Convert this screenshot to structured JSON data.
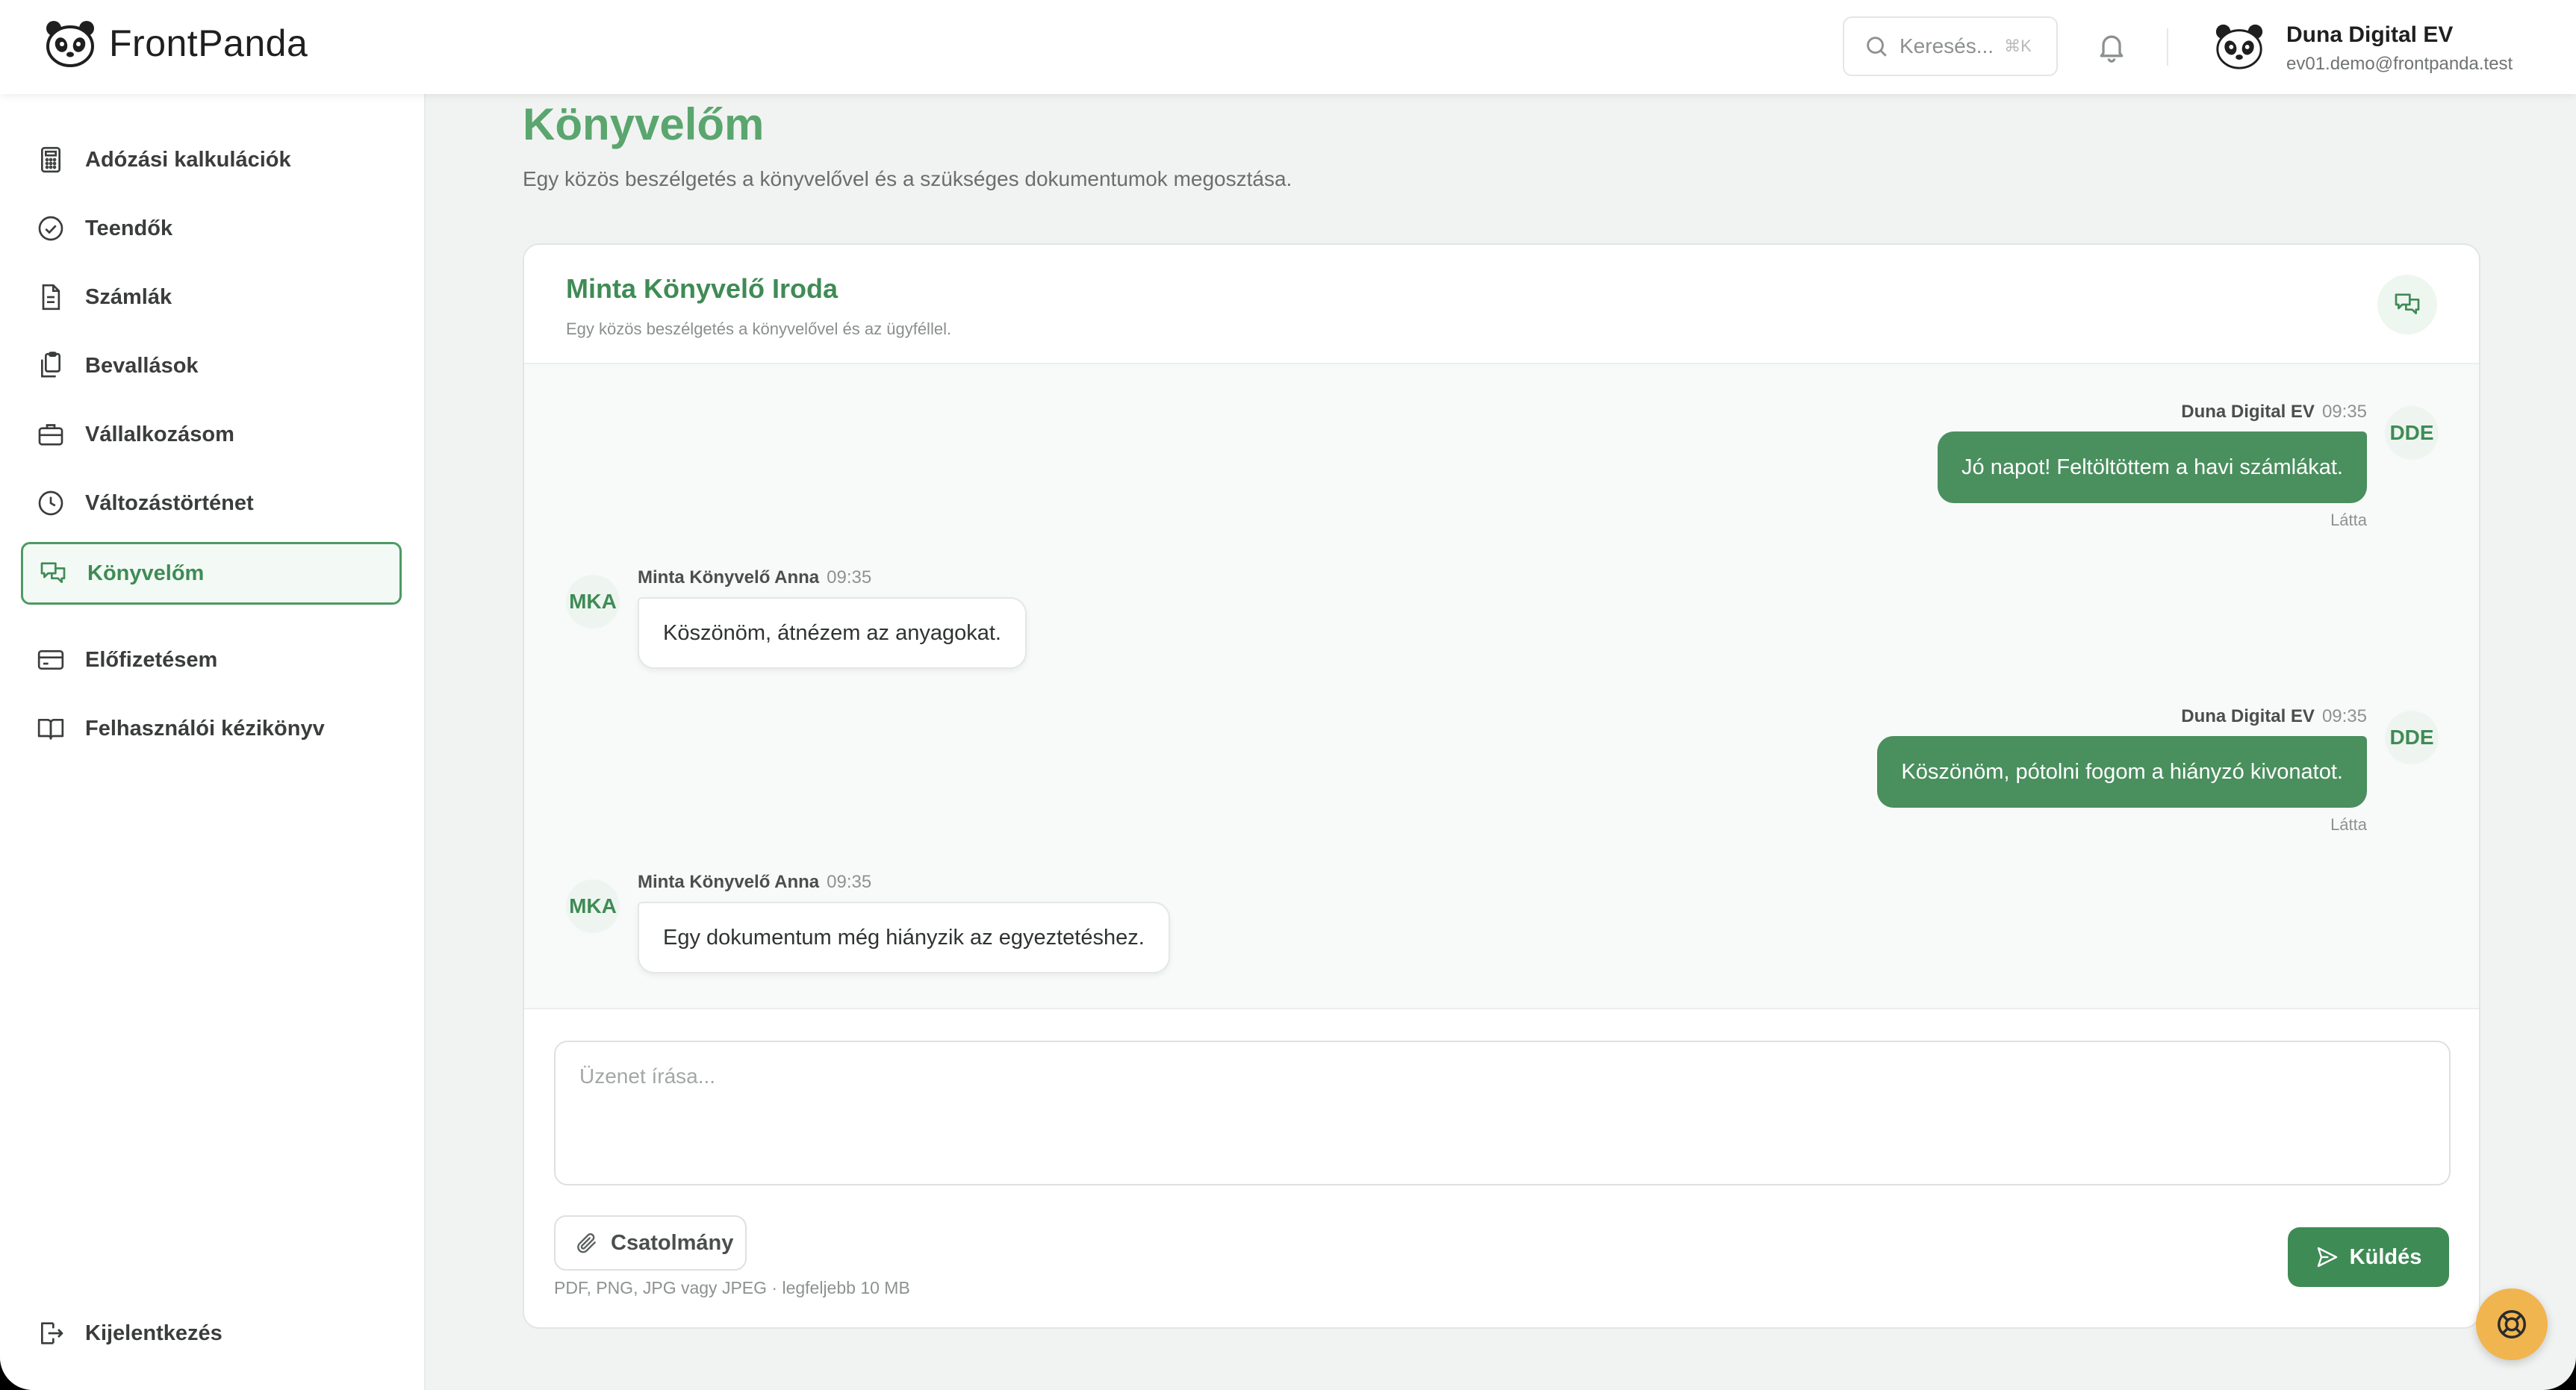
{
  "brand": {
    "name": "FrontPanda"
  },
  "header": {
    "search_placeholder": "Keresés...",
    "search_shortcut": "⌘K",
    "user_name": "Duna Digital EV",
    "user_email": "ev01.demo@frontpanda.test"
  },
  "sidebar": {
    "items": [
      {
        "label": "Adózási kalkulációk",
        "icon": "calculator-icon"
      },
      {
        "label": "Teendők",
        "icon": "check-circle-icon"
      },
      {
        "label": "Számlák",
        "icon": "document-icon"
      },
      {
        "label": "Bevallások",
        "icon": "clipboard-copy-icon"
      },
      {
        "label": "Vállalkozásom",
        "icon": "briefcase-icon"
      },
      {
        "label": "Változástörténet",
        "icon": "clock-icon"
      },
      {
        "label": "Könyvelőm",
        "icon": "chat-bubbles-icon",
        "active": true
      },
      {
        "label": "Előfizetésem",
        "icon": "credit-card-icon"
      },
      {
        "label": "Felhasználói kézikönyv",
        "icon": "book-icon"
      }
    ],
    "logout": {
      "label": "Kijelentkezés",
      "icon": "logout-icon"
    }
  },
  "page": {
    "title": "Könyvelőm",
    "subtitle": "Egy közös beszélgetés a könyvelővel és a szükséges dokumentumok megosztása."
  },
  "chat": {
    "title": "Minta Könyvelő Iroda",
    "subtitle": "Egy közös beszélgetés a könyvelővel és az ügyféllel.",
    "messages": [
      {
        "direction": "out",
        "sender": "Duna Digital EV",
        "time": "09:35",
        "initials": "DDE",
        "text": "Jó napot! Feltöltöttem a havi számlákat.",
        "status": "Látta"
      },
      {
        "direction": "in",
        "sender": "Minta Könyvelő Anna",
        "time": "09:35",
        "initials": "MKA",
        "text": "Köszönöm, átnézem az anyagokat."
      },
      {
        "direction": "out",
        "sender": "Duna Digital EV",
        "time": "09:35",
        "initials": "DDE",
        "text": "Köszönöm, pótolni fogom a hiányzó kivonatot.",
        "status": "Látta"
      },
      {
        "direction": "in",
        "sender": "Minta Könyvelő Anna",
        "time": "09:35",
        "initials": "MKA",
        "text": "Egy dokumentum még hiányzik az egyeztetéshez."
      }
    ],
    "composer_placeholder": "Üzenet írása...",
    "attach_label": "Csatolmány",
    "attach_hint": "PDF, PNG, JPG vagy JPEG · legfeljebb 10 MB",
    "send_label": "Küldés"
  },
  "colors": {
    "accent": "#3f8b55",
    "bubble": "#4a8f5e",
    "help": "#f0b54f"
  }
}
